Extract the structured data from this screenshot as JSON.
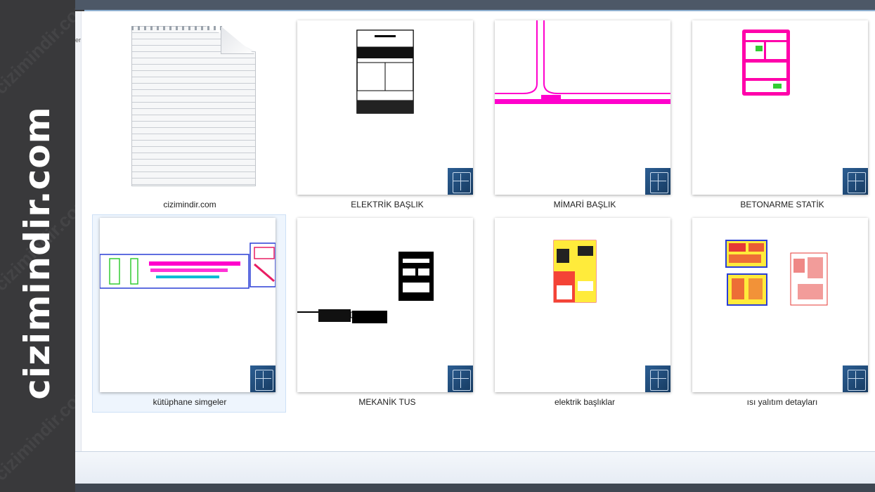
{
  "brand": {
    "text": "cizimindir.com",
    "watermark": "cizimindir.com"
  },
  "window": {
    "nav_char": "er"
  },
  "files": [
    {
      "name": "cizimindir.com",
      "type": "document-icon",
      "selected": false
    },
    {
      "name": "ELEKTRİK BAŞLIK",
      "type": "dwg-icon",
      "preview": "title-block-black",
      "selected": false
    },
    {
      "name": "MİMARİ BAŞLIK",
      "type": "dwg-icon",
      "preview": "magenta-lines",
      "selected": false
    },
    {
      "name": "BETONARME STATİK",
      "type": "dwg-icon",
      "preview": "magenta-title-block",
      "selected": false
    },
    {
      "name": "kütüphane simgeler",
      "type": "dwg-icon",
      "preview": "symbol-library",
      "selected": true
    },
    {
      "name": "MEKANİK TUS",
      "type": "dwg-icon",
      "preview": "black-blocks",
      "selected": false
    },
    {
      "name": "elektrik başlıklar",
      "type": "dwg-icon",
      "preview": "red-yellow-blocks",
      "selected": false
    },
    {
      "name": "ısı yalıtım detayları",
      "type": "dwg-icon",
      "preview": "detail-sheets",
      "selected": false
    }
  ],
  "colors": {
    "accent_magenta": "#ff00cc",
    "selection": "#eef5fd",
    "sidebar": "#39393b",
    "dwg_icon": "#1f4a78"
  }
}
